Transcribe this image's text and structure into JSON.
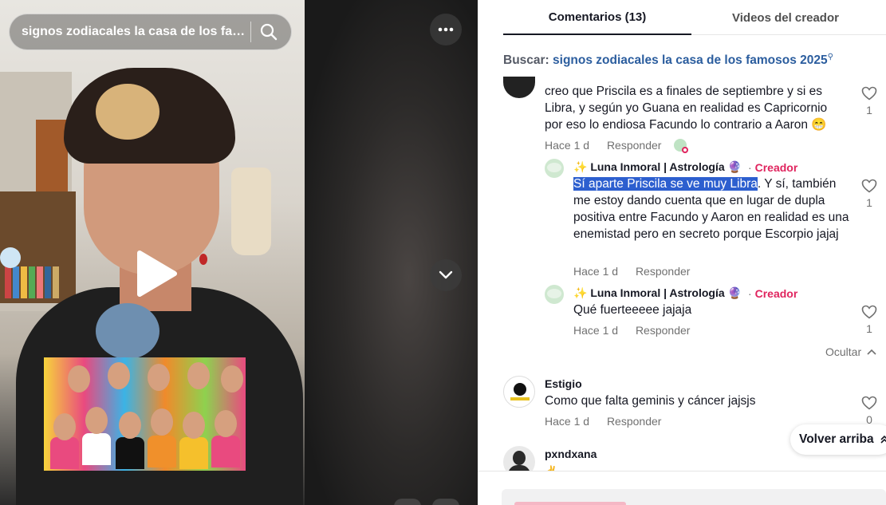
{
  "video": {
    "search_query": "signos zodiacales la casa de los fam...",
    "icons": {
      "search": "search-icon",
      "more": "more-dots-icon",
      "next": "chevron-down-icon",
      "play": "play-icon"
    }
  },
  "panel": {
    "tabs": [
      {
        "label": "Comentarios (13)",
        "active": true
      },
      {
        "label": "Videos del creador",
        "active": false
      }
    ],
    "search_hint": {
      "label": "Buscar:",
      "query": "signos zodiacales la casa de los famosos 2025"
    },
    "comments": [
      {
        "text": "creo que Priscila es a finales de septiembre y si es Libra, y según yo Guana en realidad es Capricornio por eso lo endiosa Facundo lo contrario a Aaron 😁",
        "time": "Hace 1 d",
        "reply": "Responder",
        "likes": "1",
        "replies": [
          {
            "author": "✨ Luna Inmoral | Astrología 🔮",
            "badge": "Creador",
            "highlight": "Sí aparte Priscila se ve muy Libra",
            "text": ". Y sí, también me estoy dando cuenta que en lugar de dupla positiva entre Facundo y Aaron en realidad es una enemistad pero en secreto porque Escorpio jajaj",
            "time": "Hace 1 d",
            "reply": "Responder",
            "likes": "1"
          },
          {
            "author": "✨ Luna Inmoral | Astrología 🔮",
            "badge": "Creador",
            "text": "Qué fuerteeeee jajaja",
            "time": "Hace 1 d",
            "reply": "Responder",
            "likes": "1"
          }
        ],
        "hide_label": "Ocultar"
      },
      {
        "author": "Estigio",
        "text": "Como que falta geminis y cáncer jajsjs",
        "time": "Hace 1 d",
        "reply": "Responder",
        "likes": "0"
      },
      {
        "author": "pxndxana",
        "text": "✌"
      }
    ],
    "back_to_top": "Volver arriba"
  },
  "colors": {
    "creator_badge": "#e0245e",
    "search_query": "#2b5d9e",
    "selection": "#2d5fcf"
  }
}
